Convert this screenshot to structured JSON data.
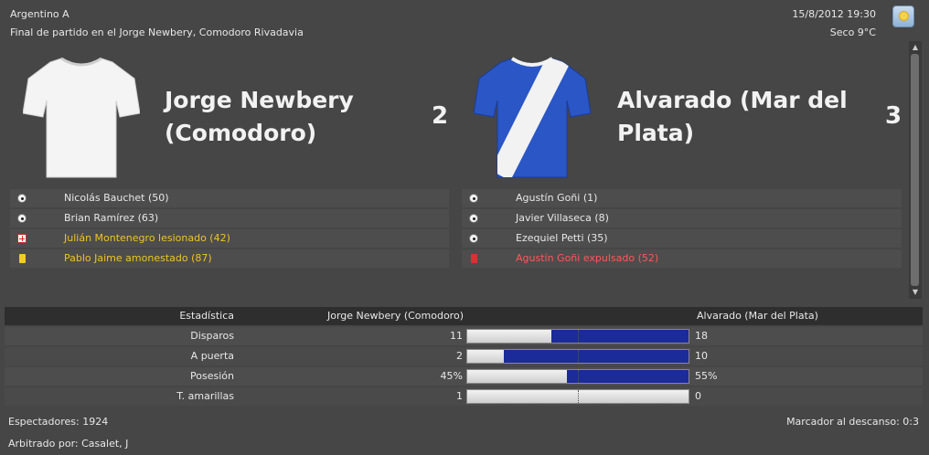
{
  "header": {
    "competition": "Argentino A",
    "status_line": "Final de partido en el Jorge Newbery, Comodoro Rivadavia",
    "datetime": "15/8/2012 19:30",
    "weather": "Seco 9°C",
    "weather_icon": "sunny-weather-icon"
  },
  "home": {
    "name_line1": "Jorge Newbery",
    "name_line2": "(Comodoro)",
    "score": "2",
    "shirt_color": "#ffffff",
    "events": [
      {
        "icon": "goal-ball-icon",
        "text": "Nicolás Bauchet (50)",
        "type": "goal"
      },
      {
        "icon": "goal-ball-icon",
        "text": "Brian Ramírez (63)",
        "type": "goal"
      },
      {
        "icon": "injury-icon",
        "text": "Julián Montenegro lesionado (42)",
        "type": "injury"
      },
      {
        "icon": "yellow-card-icon",
        "text": "Pablo Jaime amonestado (87)",
        "type": "yellow"
      }
    ]
  },
  "away": {
    "name_line1": "Alvarado (Mar del",
    "name_line2": "Plata)",
    "score": "3",
    "shirt_color": "#2a56c6",
    "events": [
      {
        "icon": "goal-ball-icon",
        "text": "Agustín Goñi (1)",
        "type": "goal"
      },
      {
        "icon": "goal-ball-icon",
        "text": "Javier Villaseca (8)",
        "type": "goal"
      },
      {
        "icon": "goal-ball-icon",
        "text": "Ezequiel Petti (35)",
        "type": "goal"
      },
      {
        "icon": "red-card-icon",
        "text": "Agustín Goñi expulsado (52)",
        "type": "red"
      }
    ]
  },
  "stats": {
    "head_label": "Estadística",
    "head_home": "Jorge Newbery (Comodoro)",
    "head_away": "Alvarado (Mar del Plata)",
    "rows": [
      {
        "label": "Disparos",
        "home": "11",
        "away": "18",
        "home_share": 0.379
      },
      {
        "label": "A puerta",
        "home": "2",
        "away": "10",
        "home_share": 0.167
      },
      {
        "label": "Posesión",
        "home": "45%",
        "away": "55%",
        "home_share": 0.45
      },
      {
        "label": "T. amarillas",
        "home": "1",
        "away": "0",
        "home_share": 1.0
      }
    ]
  },
  "footer": {
    "spectators": "Espectadores: 1924",
    "halftime": "Marcador al descanso: 0:3",
    "referee": "Arbitrado por: Casalet, J"
  },
  "colors": {
    "background": "#464646",
    "bar_away": "#1b2b9a",
    "bar_home": "#e6e6e6",
    "yellow_text": "#f0c420",
    "red_text": "#ff5858"
  }
}
